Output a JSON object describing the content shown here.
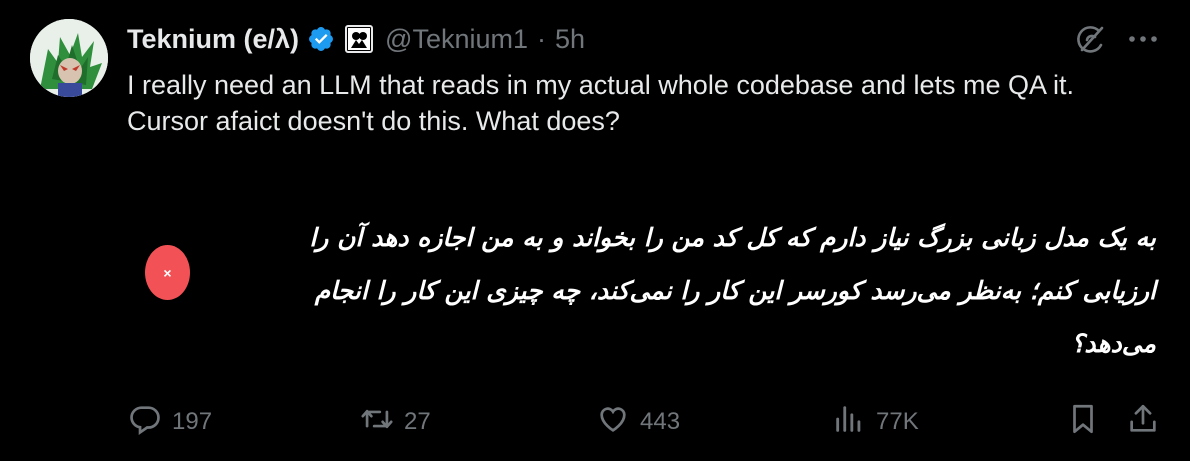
{
  "author": {
    "display_name": "Teknium (e/λ)",
    "handle": "@Teknium1",
    "separator": "·",
    "time": "5h"
  },
  "tweet": {
    "text": "I really need an LLM that reads in my actual whole codebase and lets me QA it. Cursor afaict doesn't do this. What does?"
  },
  "translation": {
    "text": "به یک مدل زبانی بزرگ نیاز دارم که کل کد من را بخواند و به من اجازه دهد آن را ارزیابی کنم؛ به‌نظر می‌رسد کورسر این کار را نمی‌کند، چه چیزی این کار را انجام می‌دهد؟",
    "close_label": "×"
  },
  "actions": {
    "replies": "197",
    "reposts": "27",
    "likes": "443",
    "views": "77K"
  },
  "colors": {
    "background": "#000000",
    "text": "#e7e9ea",
    "muted": "#71767b",
    "verified": "#1d9bf0",
    "close_dot": "#f25255"
  },
  "icons": [
    "grok-icon",
    "more-icon",
    "reply-icon",
    "repost-icon",
    "like-icon",
    "views-icon",
    "bookmark-icon",
    "share-icon",
    "verified-icon"
  ]
}
